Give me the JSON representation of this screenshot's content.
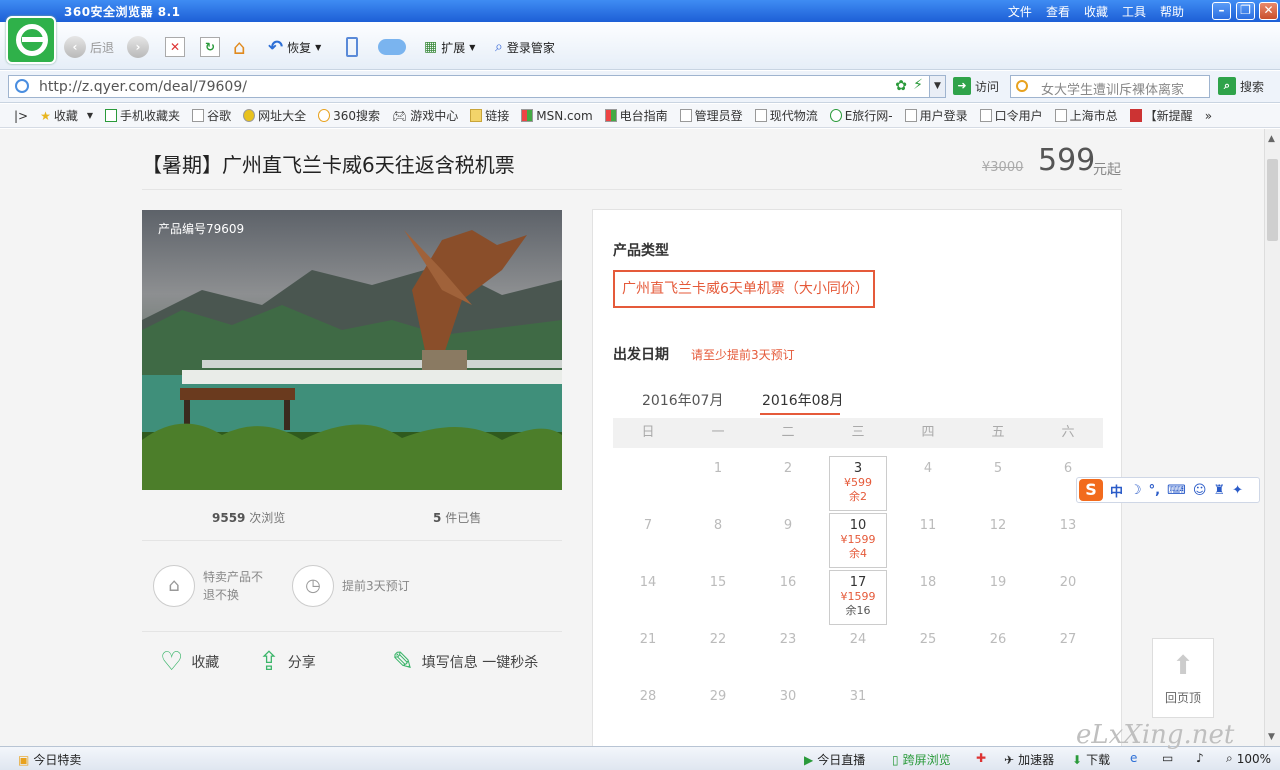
{
  "browser": {
    "title": "360安全浏览器 8.1",
    "menus": [
      "文件",
      "查看",
      "收藏",
      "工具",
      "帮助"
    ],
    "nav": {
      "back": "后退",
      "restore": "恢复",
      "extend": "扩展",
      "login": "登录管家"
    },
    "url": "http://z.qyer.com/deal/79609/",
    "visit": "访问",
    "search_placeholder": "女大学生遭训斥裸体离家",
    "search_btn": "搜索",
    "favorites": [
      "收藏",
      "手机收藏夹",
      "谷歌",
      "网址大全",
      "360搜索",
      "游戏中心",
      "链接",
      "MSN.com",
      "电台指南",
      "管理员登",
      "现代物流",
      "E旅行网-",
      "用户登录",
      "口令用户",
      "上海市总",
      "【新提醒"
    ]
  },
  "deal": {
    "title": "【暑期】广州直飞兰卡威6天往返含税机票",
    "old_price": "¥3000",
    "price": "599",
    "price_unit": "元起",
    "photo_id": "产品编号79609",
    "views_num": "9559",
    "views_label": "次浏览",
    "sold_num": "5",
    "sold_label": "件已售",
    "badges": [
      "特卖产品不退不换",
      "提前3天预订"
    ],
    "actions": {
      "fav": "收藏",
      "share": "分享",
      "fill": "填写信息 一键秒杀"
    }
  },
  "booking": {
    "type_heading": "产品类型",
    "type_option": "广州直飞兰卡威6天单机票（大小同价）",
    "date_heading": "出发日期",
    "date_tip": "请至少提前3天预订",
    "months": [
      "2016年07月",
      "2016年08月"
    ],
    "weekdays": [
      "日",
      "一",
      "二",
      "三",
      "四",
      "五",
      "六"
    ],
    "weeks": [
      [
        {
          "d": ""
        },
        {
          "d": "1"
        },
        {
          "d": "2"
        },
        {
          "d": "3",
          "price": "¥599",
          "remain": "余2"
        },
        {
          "d": "4"
        },
        {
          "d": "5"
        },
        {
          "d": "6"
        }
      ],
      [
        {
          "d": "7"
        },
        {
          "d": "8"
        },
        {
          "d": "9"
        },
        {
          "d": "10",
          "price": "¥1599",
          "remain": "余4"
        },
        {
          "d": "11"
        },
        {
          "d": "12"
        },
        {
          "d": "13"
        }
      ],
      [
        {
          "d": "14"
        },
        {
          "d": "15"
        },
        {
          "d": "16"
        },
        {
          "d": "17",
          "price": "¥1599",
          "remain": "余16"
        },
        {
          "d": "18"
        },
        {
          "d": "19"
        },
        {
          "d": "20"
        }
      ],
      [
        {
          "d": "21"
        },
        {
          "d": "22"
        },
        {
          "d": "23"
        },
        {
          "d": "24"
        },
        {
          "d": "25"
        },
        {
          "d": "26"
        },
        {
          "d": "27"
        }
      ],
      [
        {
          "d": "28"
        },
        {
          "d": "29"
        },
        {
          "d": "30"
        },
        {
          "d": "31"
        }
      ]
    ]
  },
  "totop": "回页顶",
  "ime": {
    "label": "中"
  },
  "status": {
    "left": "今日特卖",
    "live": "今日直播",
    "cross": "跨屏浏览",
    "accel": "加速器",
    "download": "下载",
    "zoom": "100%"
  },
  "watermark": "eLxXing.net"
}
